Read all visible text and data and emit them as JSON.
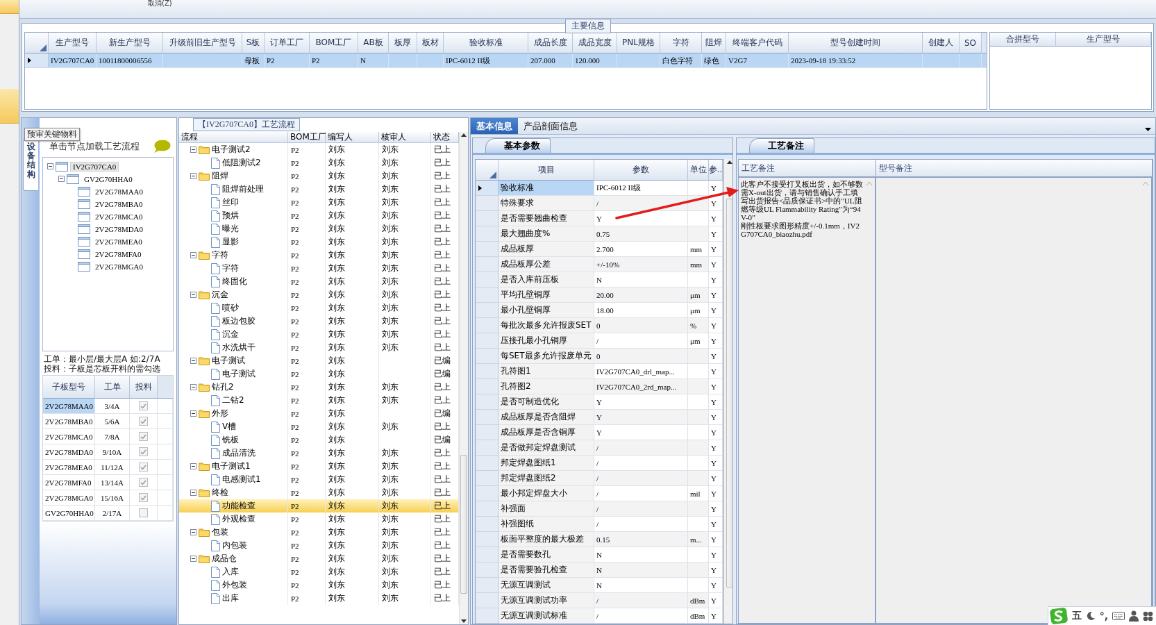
{
  "toolbar": {
    "cancel": "取消(Z)"
  },
  "main_info": {
    "title": "主要信息",
    "columns": [
      "生产型号",
      "新生产型号",
      "升级前旧生产型号",
      "S板",
      "订单工厂",
      "BOM工厂",
      "AB板",
      "板厚",
      "板材",
      "验收标准",
      "成品长度",
      "成品宽度",
      "PNL规格",
      "字符",
      "阻焊",
      "终端客户代码",
      "型号创建时间",
      "创建人",
      "SO"
    ],
    "rows": [
      {
        "selected": true,
        "cells": [
          "IV2G707CA0",
          "10011800006556",
          "",
          "母板",
          "P2",
          "P2",
          "N",
          "",
          "",
          "IPC-6012 II级",
          "207.000",
          "120.000",
          "",
          "白色字符",
          "绿色",
          "V2G7",
          "2023-09-18 19:33:52",
          "",
          ""
        ]
      }
    ],
    "merge_columns": [
      "合拼型号",
      "生产型号"
    ]
  },
  "structure_panel": {
    "tab": "预审关键物料",
    "side_tab": "设备结构",
    "hint": "单击节点加载工艺流程",
    "tree": [
      {
        "label": "IV2G707CA0",
        "selected": true,
        "expanded": true,
        "children": [
          {
            "label": "GV2G70HHA0",
            "selected": false,
            "expanded": true,
            "children": [
              {
                "label": "2V2G78MAA0",
                "selected": false
              },
              {
                "label": "2V2G78MBA0",
                "selected": false
              },
              {
                "label": "2V2G78MCA0",
                "selected": false
              },
              {
                "label": "2V2G78MDA0",
                "selected": false
              },
              {
                "label": "2V2G78MEA0",
                "selected": false
              },
              {
                "label": "2V2G78MFA0",
                "selected": false
              },
              {
                "label": "2V2G78MGA0",
                "selected": false
              }
            ]
          }
        ]
      }
    ],
    "note": [
      "工单：最小层/最大层A 如:2/7A",
      "投料：子板是芯板开料的需勾选"
    ],
    "grid_columns": [
      "子板型号",
      "工单",
      "投料"
    ],
    "grid_rows": [
      {
        "model": "2V2G78MAA0",
        "order": "3/4A",
        "checked": true,
        "selected": true
      },
      {
        "model": "2V2G78MBA0",
        "order": "5/6A",
        "checked": true,
        "selected": false
      },
      {
        "model": "2V2G78MCA0",
        "order": "7/8A",
        "checked": true,
        "selected": false
      },
      {
        "model": "2V2G78MDA0",
        "order": "9/10A",
        "checked": true,
        "selected": false
      },
      {
        "model": "2V2G78MEA0",
        "order": "11/12A",
        "checked": true,
        "selected": false
      },
      {
        "model": "2V2G78MFA0",
        "order": "13/14A",
        "checked": true,
        "selected": false
      },
      {
        "model": "2V2G78MGA0",
        "order": "15/16A",
        "checked": true,
        "selected": false
      },
      {
        "model": "GV2G70HHA0",
        "order": "2/17A",
        "checked": false,
        "selected": false
      }
    ]
  },
  "process_panel": {
    "title": "【IV2G707CA0】工艺流程",
    "columns": [
      "流程",
      "BOM工厂",
      "编写人",
      "核审人",
      "状态"
    ],
    "tree": [
      {
        "name": "电子测试2",
        "bom": "P2",
        "writer": "刘东",
        "reviewer": "刘东",
        "status": "已上",
        "selected": false,
        "expanded": true,
        "children": [
          {
            "name": "低阻测试2",
            "bom": "P2",
            "writer": "刘东",
            "reviewer": "刘东",
            "status": "已上",
            "selected": false
          }
        ]
      },
      {
        "name": "阻焊",
        "bom": "P2",
        "writer": "刘东",
        "reviewer": "刘东",
        "status": "已上",
        "selected": false,
        "expanded": true,
        "children": [
          {
            "name": "阻焊前处理",
            "bom": "P2",
            "writer": "刘东",
            "reviewer": "刘东",
            "status": "已上",
            "selected": false
          },
          {
            "name": "丝印",
            "bom": "P2",
            "writer": "刘东",
            "reviewer": "刘东",
            "status": "已上",
            "selected": false
          },
          {
            "name": "预烘",
            "bom": "P2",
            "writer": "刘东",
            "reviewer": "刘东",
            "status": "已上",
            "selected": false
          },
          {
            "name": "曝光",
            "bom": "P2",
            "writer": "刘东",
            "reviewer": "刘东",
            "status": "已上",
            "selected": false
          },
          {
            "name": "显影",
            "bom": "P2",
            "writer": "刘东",
            "reviewer": "刘东",
            "status": "已上",
            "selected": false
          }
        ]
      },
      {
        "name": "字符",
        "bom": "P2",
        "writer": "刘东",
        "reviewer": "刘东",
        "status": "已上",
        "selected": false,
        "expanded": true,
        "children": [
          {
            "name": "字符",
            "bom": "P2",
            "writer": "刘东",
            "reviewer": "刘东",
            "status": "已上",
            "selected": false
          },
          {
            "name": "终固化",
            "bom": "P2",
            "writer": "刘东",
            "reviewer": "刘东",
            "status": "已上",
            "selected": false
          }
        ]
      },
      {
        "name": "沉金",
        "bom": "P2",
        "writer": "刘东",
        "reviewer": "刘东",
        "status": "已上",
        "selected": false,
        "expanded": true,
        "children": [
          {
            "name": "喷砂",
            "bom": "P2",
            "writer": "刘东",
            "reviewer": "刘东",
            "status": "已上",
            "selected": false
          },
          {
            "name": "板边包胶",
            "bom": "P2",
            "writer": "刘东",
            "reviewer": "刘东",
            "status": "已上",
            "selected": false
          },
          {
            "name": "沉金",
            "bom": "P2",
            "writer": "刘东",
            "reviewer": "刘东",
            "status": "已上",
            "selected": false
          },
          {
            "name": "水洗烘干",
            "bom": "P2",
            "writer": "刘东",
            "reviewer": "刘东",
            "status": "已上",
            "selected": false
          }
        ]
      },
      {
        "name": "电子测试",
        "bom": "P2",
        "writer": "刘东",
        "status": "已编",
        "selected": false,
        "expanded": true,
        "children": [
          {
            "name": "电子测试",
            "bom": "P2",
            "writer": "刘东",
            "status": "已编",
            "selected": false
          }
        ]
      },
      {
        "name": "钻孔2",
        "bom": "P2",
        "writer": "刘东",
        "reviewer": "刘东",
        "status": "已上",
        "selected": false,
        "expanded": true,
        "children": [
          {
            "name": "二钻2",
            "bom": "P2",
            "writer": "刘东",
            "reviewer": "刘东",
            "status": "已上",
            "selected": false
          }
        ]
      },
      {
        "name": "外形",
        "bom": "P2",
        "writer": "刘东",
        "status": "已编",
        "selected": false,
        "expanded": true,
        "children": [
          {
            "name": "V槽",
            "bom": "P2",
            "writer": "刘东",
            "reviewer": "刘东",
            "status": "已上",
            "selected": false
          },
          {
            "name": "铣板",
            "bom": "P2",
            "writer": "刘东",
            "status": "已编",
            "selected": false
          },
          {
            "name": "成品清洗",
            "bom": "P2",
            "writer": "刘东",
            "reviewer": "刘东",
            "status": "已上",
            "selected": false
          }
        ]
      },
      {
        "name": "电子测试1",
        "bom": "P2",
        "writer": "刘东",
        "reviewer": "刘东",
        "status": "已上",
        "selected": false,
        "expanded": true,
        "children": [
          {
            "name": "电感测试1",
            "bom": "P2",
            "writer": "刘东",
            "reviewer": "刘东",
            "status": "已上",
            "selected": false
          }
        ]
      },
      {
        "name": "终检",
        "bom": "P2",
        "writer": "刘东",
        "reviewer": "刘东",
        "status": "已上",
        "selected": false,
        "expanded": true,
        "children": [
          {
            "name": "功能检查",
            "bom": "P2",
            "writer": "刘东",
            "reviewer": "刘东",
            "status": "已上",
            "selected": true
          },
          {
            "name": "外观检查",
            "bom": "P2",
            "writer": "刘东",
            "reviewer": "刘东",
            "status": "已上",
            "selected": false
          }
        ]
      },
      {
        "name": "包装",
        "bom": "P2",
        "writer": "刘东",
        "reviewer": "刘东",
        "status": "已上",
        "selected": false,
        "expanded": true,
        "children": [
          {
            "name": "内包装",
            "bom": "P2",
            "writer": "刘东",
            "reviewer": "刘东",
            "status": "已上",
            "selected": false
          }
        ]
      },
      {
        "name": "成品仓",
        "bom": "P2",
        "writer": "刘东",
        "reviewer": "刘东",
        "status": "已上",
        "selected": false,
        "expanded": true,
        "children": [
          {
            "name": "入库",
            "bom": "P2",
            "writer": "刘东",
            "reviewer": "刘东",
            "status": "已上",
            "selected": false
          },
          {
            "name": "外包装",
            "bom": "P2",
            "writer": "刘东",
            "reviewer": "刘东",
            "status": "已上",
            "selected": false
          },
          {
            "name": "出库",
            "bom": "P2",
            "writer": "刘东",
            "reviewer": "刘东",
            "status": "已上",
            "selected": false
          }
        ]
      }
    ]
  },
  "detail_panel": {
    "tabs": [
      {
        "label": "基本信息",
        "selected": true
      },
      {
        "label": "产品剖面信息",
        "selected": false
      }
    ],
    "params": {
      "tab": "基本参数",
      "columns": [
        "项目",
        "参数",
        "单位",
        "参.."
      ],
      "rows": [
        {
          "item": "验收标准",
          "value": "IPC-6012 II级",
          "unit": "",
          "column_4": "Y",
          "selected": true
        },
        {
          "item": "特殊要求",
          "value": "/",
          "unit": "",
          "column_4": "Y",
          "selected": false
        },
        {
          "item": "是否需要翘曲检查",
          "value": "Y",
          "unit": "",
          "column_4": "Y",
          "selected": false
        },
        {
          "item": "最大翘曲度%",
          "value": "0.75",
          "unit": "",
          "column_4": "Y",
          "selected": false
        },
        {
          "item": "成品板厚",
          "value": "2.700",
          "unit": "mm",
          "column_4": "Y",
          "selected": false
        },
        {
          "item": "成品板厚公差",
          "value": "+/-10%",
          "unit": "mm",
          "column_4": "Y",
          "selected": false
        },
        {
          "item": "是否入库前压板",
          "value": "N",
          "unit": "",
          "column_4": "Y",
          "selected": false
        },
        {
          "item": "平均孔壁铜厚",
          "value": "20.00",
          "unit": "μm",
          "column_4": "Y",
          "selected": false
        },
        {
          "item": "最小孔壁铜厚",
          "value": "18.00",
          "unit": "μm",
          "column_4": "Y",
          "selected": false
        },
        {
          "item": "每批次最多允许报废SET",
          "value": "0",
          "unit": "%",
          "column_4": "Y",
          "selected": false
        },
        {
          "item": "压接孔最小孔铜厚",
          "value": "/",
          "unit": "μm",
          "column_4": "Y",
          "selected": false
        },
        {
          "item": "每SET最多允许报废单元",
          "value": "0",
          "unit": "",
          "column_4": "Y",
          "selected": false
        },
        {
          "item": "孔符图1",
          "value": "IV2G707CA0_drl_map...",
          "unit": "",
          "column_4": "Y",
          "selected": false
        },
        {
          "item": "孔符图2",
          "value": "IV2G707CA0_2rd_map...",
          "unit": "",
          "column_4": "Y",
          "selected": false
        },
        {
          "item": "是否可制造优化",
          "value": "Y",
          "unit": "",
          "column_4": "Y",
          "selected": false
        },
        {
          "item": "成品板厚是否含阻焊",
          "value": "Y",
          "unit": "",
          "column_4": "Y",
          "selected": false
        },
        {
          "item": "成品板厚是否含铜厚",
          "value": "Y",
          "unit": "",
          "column_4": "Y",
          "selected": false
        },
        {
          "item": "是否做邦定焊盘测试",
          "value": "/",
          "unit": "",
          "column_4": "Y",
          "selected": false
        },
        {
          "item": "邦定焊盘图纸1",
          "value": "/",
          "unit": "",
          "column_4": "Y",
          "selected": false
        },
        {
          "item": "邦定焊盘图纸2",
          "value": "/",
          "unit": "",
          "column_4": "Y",
          "selected": false
        },
        {
          "item": "最小邦定焊盘大小",
          "value": "/",
          "unit": "mil",
          "column_4": "Y",
          "selected": false
        },
        {
          "item": "补强面",
          "value": "/",
          "unit": "",
          "column_4": "Y",
          "selected": false
        },
        {
          "item": "补强图纸",
          "value": "/",
          "unit": "",
          "column_4": "Y",
          "selected": false
        },
        {
          "item": "板面平整度的最大极差",
          "value": "0.15",
          "unit": "m...",
          "column_4": "Y",
          "selected": false
        },
        {
          "item": "是否需要数孔",
          "value": "N",
          "unit": "",
          "column_4": "Y",
          "selected": false
        },
        {
          "item": "是否需要验孔检查",
          "value": "N",
          "unit": "",
          "column_4": "Y",
          "selected": false
        },
        {
          "item": "无源互调测试",
          "value": "N",
          "unit": "",
          "column_4": "Y",
          "selected": false
        },
        {
          "item": "无源互调测试功率",
          "value": "/",
          "unit": "dBm",
          "column_4": "Y",
          "selected": false
        },
        {
          "item": "无源互调测试标准",
          "value": "/",
          "unit": "dBm",
          "column_4": "Y",
          "selected": false
        }
      ]
    },
    "remarks": {
      "tab": "工艺备注",
      "columns": [
        "工艺备注",
        "型号备注"
      ],
      "process_note": [
        "此客户不接受打叉板出货，如不够数需X-out出货，请与销售确认手工填写出货报告<品质保证书>中的\"UL阻燃等级UL Flammability Rating\"为“94V-0”",
        "刚性板要求图形精度+/-0.1mm，IV2G707CA0_biaozhu.pdf"
      ]
    }
  },
  "ime_bar": {
    "mode": "五",
    "punct": "°,"
  }
}
